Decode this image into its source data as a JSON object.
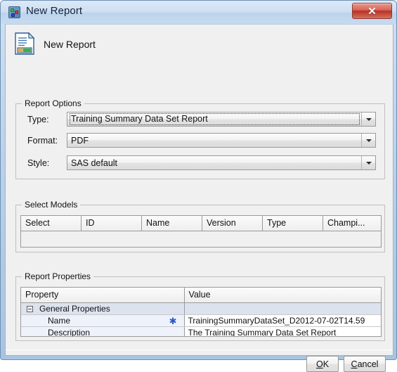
{
  "window": {
    "title": "New Report",
    "title_icon": "app-icon",
    "close_label": "✖"
  },
  "header": {
    "title": "New Report",
    "icon": "report-document-icon"
  },
  "report_options": {
    "legend": "Report Options",
    "fields": [
      {
        "label": "Type:",
        "value": "Training Summary Data Set Report",
        "focused": true
      },
      {
        "label": "Format:",
        "value": "PDF",
        "focused": false
      },
      {
        "label": "Style:",
        "value": "SAS default",
        "focused": false
      }
    ]
  },
  "select_models": {
    "legend": "Select Models",
    "columns": [
      "Select",
      "ID",
      "Name",
      "Version",
      "Type",
      "Champi..."
    ],
    "rows": []
  },
  "report_properties": {
    "legend": "Report Properties",
    "columns": [
      "Property",
      "Value"
    ],
    "rows": [
      {
        "kind": "group",
        "property": "General Properties",
        "value": "",
        "required": false
      },
      {
        "kind": "item",
        "property": "Name",
        "value": "TrainingSummaryDataSet_D2012-07-02T14.59",
        "required": true
      },
      {
        "kind": "item",
        "property": "Description",
        "value": "The Training Summary Data Set Report",
        "required": false
      }
    ],
    "required_marker": "✱"
  },
  "footer": {
    "ok": {
      "mnemonic": "O",
      "rest": "K"
    },
    "cancel": {
      "mnemonic": "C",
      "rest": "ancel"
    }
  },
  "colors": {
    "titlebar": "#cfe0f2",
    "close_red": "#b93325",
    "dialog_bg": "#f0f0f0",
    "group_row": "#dce3ef",
    "item_row": "#eef2fb",
    "required_star": "#2f57c4"
  }
}
